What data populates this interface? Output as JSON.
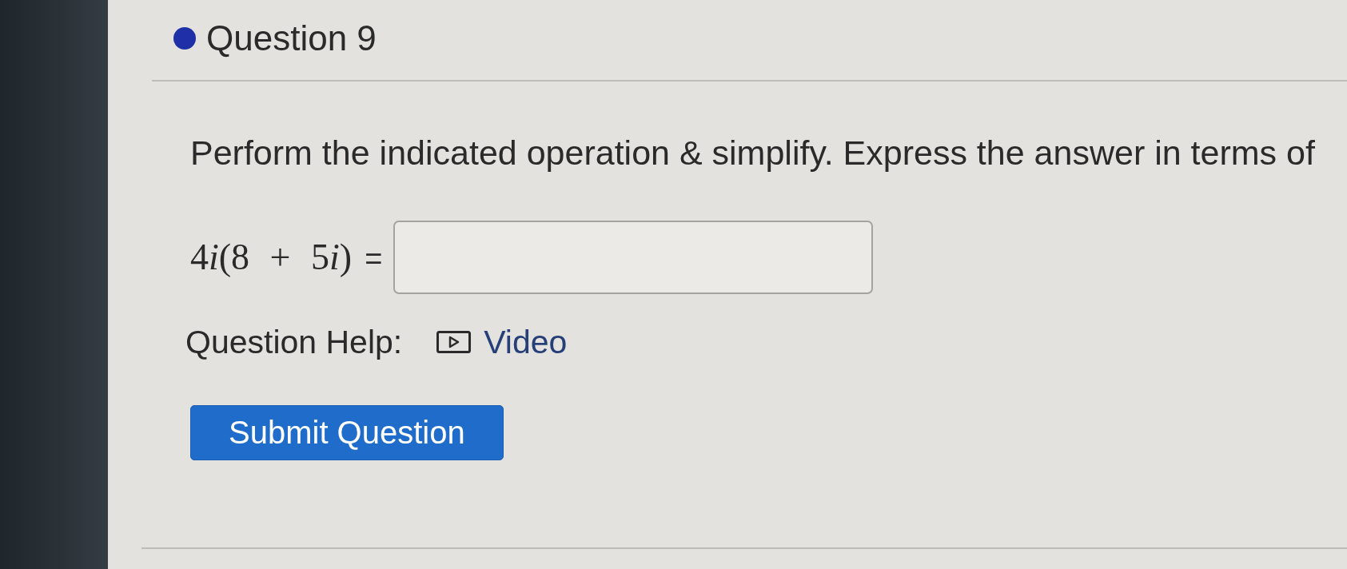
{
  "question": {
    "title": "Question 9"
  },
  "prompt": "Perform the indicated operation & simplify. Express the answer in terms of",
  "equation": {
    "expression": [
      {
        "kind": "number",
        "text": "4"
      },
      {
        "kind": "variable",
        "text": "i"
      },
      {
        "kind": "number",
        "text": "(8 + 5"
      },
      {
        "kind": "variable",
        "text": "i"
      },
      {
        "kind": "number",
        "text": ")"
      },
      {
        "kind": "sign",
        "text": "="
      }
    ]
  },
  "help": {
    "label": "Question Help:",
    "links": [
      {
        "label": "Video"
      }
    ]
  },
  "submit_button": {
    "label": "Submit Question"
  }
}
